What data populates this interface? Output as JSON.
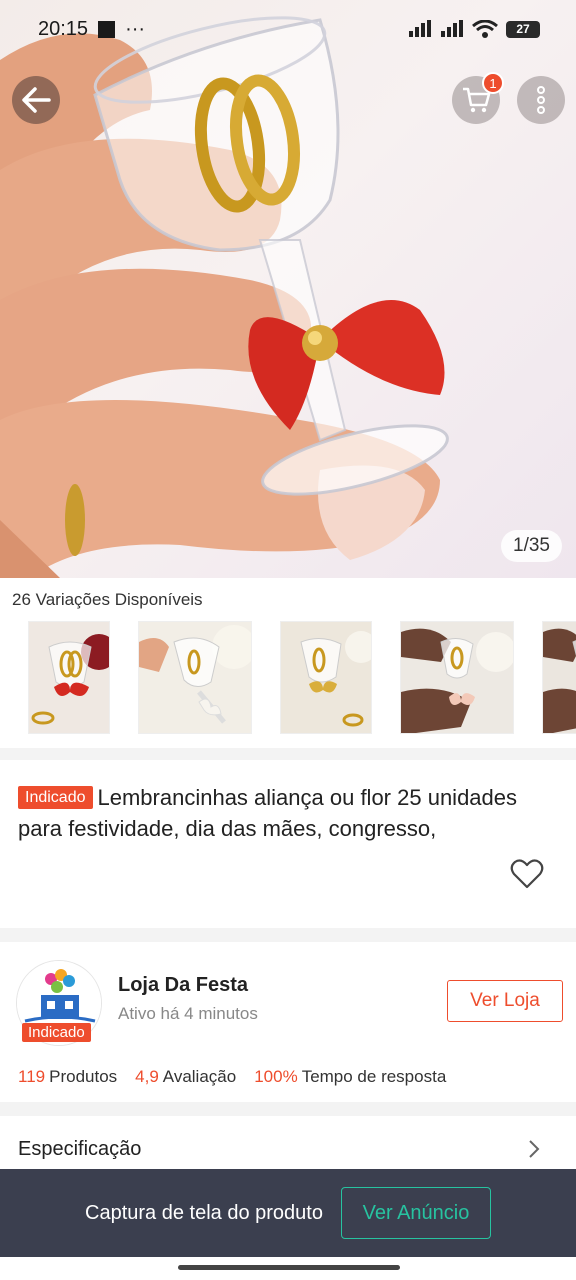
{
  "status_bar": {
    "time": "20:15",
    "ellipsis": "···",
    "battery": "27"
  },
  "hero": {
    "image_counter": "1/35",
    "cart_count": "1"
  },
  "variations": {
    "title": "26 Variações Disponíveis"
  },
  "product": {
    "tag": "Indicado",
    "title": "Lembrancinhas aliança ou flor 25 unidades para festividade, dia das mães, congresso,"
  },
  "shop": {
    "name": "Loja Da Festa",
    "active": "Ativo há 4 minutos",
    "tag": "Indicado",
    "view_button": "Ver Loja",
    "stats": [
      {
        "value": "119",
        "label": "Produtos"
      },
      {
        "value": "4,9",
        "label": "Avaliação"
      },
      {
        "value": "100%",
        "label": "Tempo de resposta"
      }
    ]
  },
  "spec": {
    "label": "Especificação"
  },
  "banner": {
    "text": "Captura de tela do produto",
    "button": "Ver Anúncio"
  },
  "colors": {
    "accent": "#ee4d2d",
    "teal": "#27c3a0",
    "banner_bg": "#3b3f4f"
  }
}
